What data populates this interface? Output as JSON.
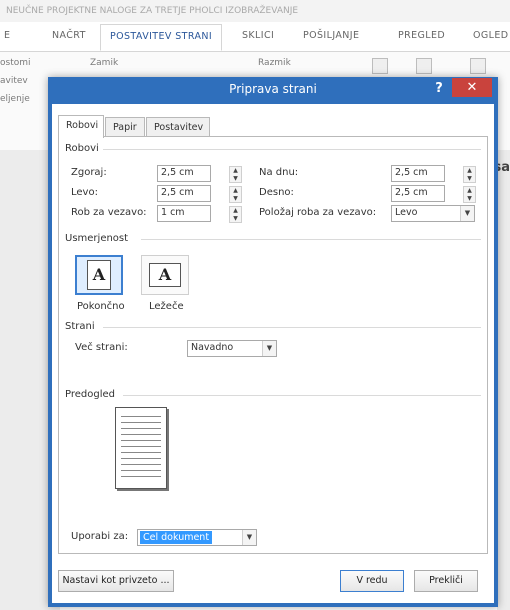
{
  "window": {
    "title_text": "NEUČNE PROJEKTNE NALOGE ZA TRETJE PHOLCI IZOBRAŽEVANJE"
  },
  "ribbon": {
    "tabs": [
      {
        "label": "E"
      },
      {
        "label": "NAČRT"
      },
      {
        "label": "POSTAVITEV STRANI"
      },
      {
        "label": "SKLICI"
      },
      {
        "label": "POŠILJANJE"
      },
      {
        "label": "PREGLED"
      },
      {
        "label": "OGLED"
      }
    ],
    "left_labels": [
      "ostomi",
      "avitev",
      "eljenje"
    ],
    "middle_labels": [
      "Zamik",
      "Razmik"
    ],
    "side_text": "sa"
  },
  "dialog": {
    "title": "Priprava strani",
    "help_glyph": "?",
    "close_glyph": "✕",
    "tabs": [
      {
        "label": "Robovi",
        "active": true
      },
      {
        "label": "Papir",
        "active": false
      },
      {
        "label": "Postavitev",
        "active": false
      }
    ],
    "margins": {
      "section_label": "Robovi",
      "top_label": "Zgoraj:",
      "top_value": "2,5 cm",
      "bottom_label": "Na dnu:",
      "bottom_value": "2,5 cm",
      "left_label": "Levo:",
      "left_value": "2,5 cm",
      "right_label": "Desno:",
      "right_value": "2,5 cm",
      "gutter_label": "Rob za vezavo:",
      "gutter_value": "1 cm",
      "gutter_pos_label": "Položaj roba za vezavo:",
      "gutter_pos_value": "Levo"
    },
    "orientation": {
      "section_label": "Usmerjenost",
      "portrait_label": "Pokončno",
      "landscape_label": "Ležeče",
      "glyph": "A",
      "selected": "portrait"
    },
    "pages": {
      "section_label": "Strani",
      "multiple_label": "Več strani:",
      "multiple_value": "Navadno"
    },
    "preview": {
      "section_label": "Predogled"
    },
    "apply": {
      "label": "Uporabi za:",
      "value": "Cel dokument"
    },
    "buttons": {
      "set_default": "Nastavi kot privzeto ...",
      "ok": "V redu",
      "cancel": "Prekliči"
    },
    "arrows": {
      "up": "▲",
      "down": "▼"
    }
  }
}
